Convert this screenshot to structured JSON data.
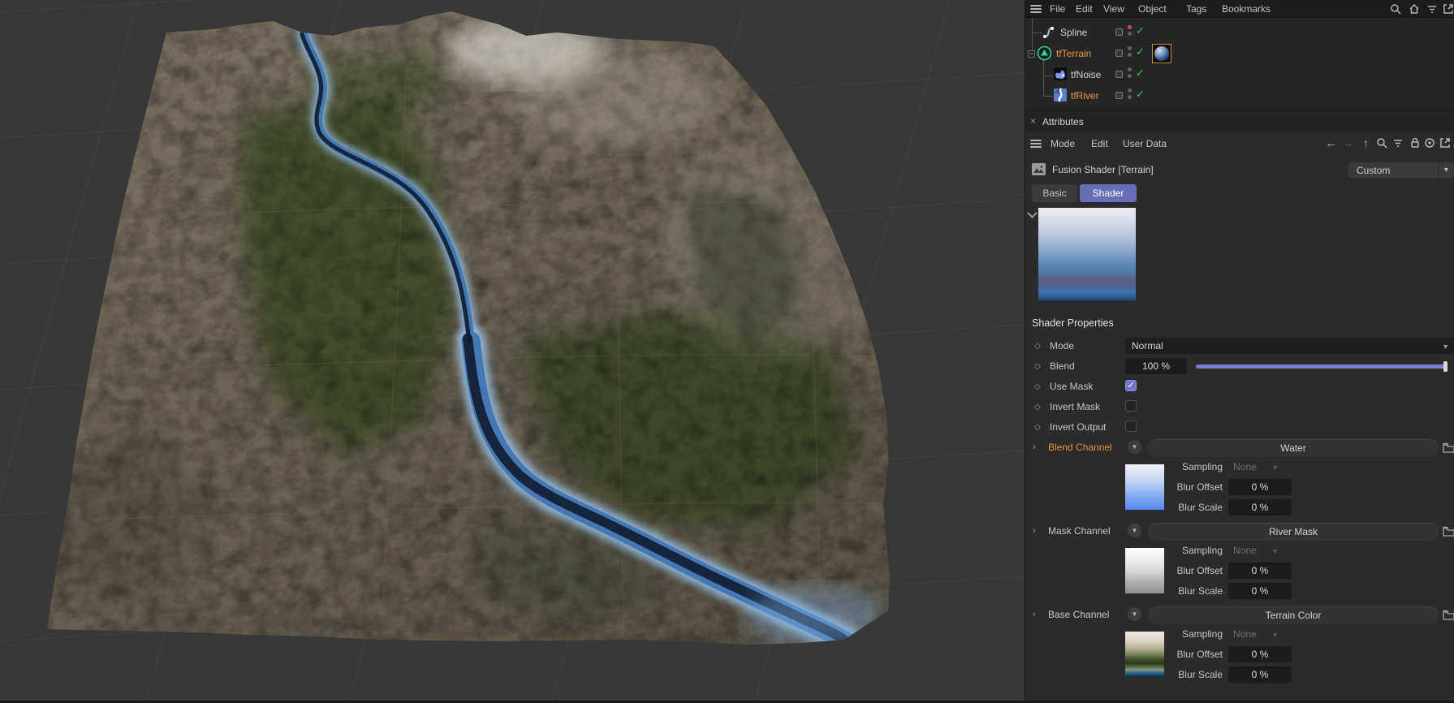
{
  "menubar": {
    "items": [
      "File",
      "Edit",
      "View",
      "Object",
      "Tags",
      "Bookmarks"
    ],
    "right_icons": [
      "search-icon",
      "home-icon",
      "filter-icon",
      "open-window-icon"
    ]
  },
  "object_tree": {
    "items": [
      {
        "name": "Spline",
        "icon": "spline-icon",
        "color": "#cfcfcf",
        "dot_top_color": "#cf4d43",
        "enabled_check": true
      },
      {
        "name": "tfTerrain",
        "icon": "terrain-operator-icon",
        "color": "#e39a45",
        "expanded": true,
        "has_material_thumbnail": true,
        "enabled_check": true
      },
      {
        "name": "tfNoise",
        "icon": "noise-icon",
        "color": "#cfcfcf",
        "enabled_check": true
      },
      {
        "name": "tfRiver",
        "icon": "river-icon",
        "color": "#e39a45",
        "enabled_check": true
      }
    ]
  },
  "attributes": {
    "title": "Attributes",
    "close_label": "×",
    "toolbar": {
      "items": [
        "Mode",
        "Edit",
        "User Data"
      ],
      "icons": [
        "back-arrow-icon",
        "forward-arrow-icon",
        "up-arrow-icon",
        "search-icon",
        "filter-icon",
        "lock-icon",
        "target-icon",
        "open-window-icon"
      ]
    },
    "object_header": {
      "title": "Fusion Shader [Terrain]",
      "preset": "Custom"
    },
    "tabs": [
      {
        "label": "Basic",
        "active": false
      },
      {
        "label": "Shader",
        "active": true
      }
    ],
    "section_title": "Shader Properties",
    "rows": {
      "mode": {
        "label": "Mode",
        "value": "Normal"
      },
      "blend": {
        "label": "Blend",
        "value": "100 %",
        "slider_percent": 100
      },
      "use_mask": {
        "label": "Use Mask",
        "checked": true
      },
      "invert_mask": {
        "label": "Invert Mask",
        "checked": false
      },
      "invert_output": {
        "label": "Invert Output",
        "checked": false
      }
    },
    "channels": [
      {
        "label": "Blend Channel",
        "label_color": "#e2913c",
        "value": "Water",
        "thumbnail": "white-to-blue-gradient",
        "sampling": {
          "label": "Sampling",
          "value": "None",
          "disabled": true
        },
        "blur_offset": {
          "label": "Blur Offset",
          "value": "0 %"
        },
        "blur_scale": {
          "label": "Blur Scale",
          "value": "0 %"
        }
      },
      {
        "label": "Mask Channel",
        "label_color": "#c9c9c9",
        "value": "River Mask",
        "thumbnail": "white-to-gray-gradient",
        "sampling": {
          "label": "Sampling",
          "value": "None",
          "disabled": true
        },
        "blur_offset": {
          "label": "Blur Offset",
          "value": "0 %"
        },
        "blur_scale": {
          "label": "Blur Scale",
          "value": "0 %"
        }
      },
      {
        "label": "Base Channel",
        "label_color": "#c9c9c9",
        "value": "Terrain Color",
        "thumbnail": "terrain-color-gradient",
        "sampling": {
          "label": "Sampling",
          "value": "None",
          "disabled": true
        },
        "blur_offset": {
          "label": "Blur Offset",
          "value": "0 %"
        },
        "blur_scale": {
          "label": "Blur Scale",
          "value": "0 %"
        }
      }
    ]
  },
  "viewport": {
    "content": "3D terrain mesh with winding blue river in perspective view",
    "colors": {
      "background": "#383838",
      "grid_line": "#474747",
      "rock_light": "#a79f8f",
      "rock_dark": "#5f594e",
      "vegetation": "#31401f",
      "river_glow": "#9cc8f2",
      "river_mid": "#4577b4",
      "river_core": "#101c30"
    }
  },
  "theme": {
    "panel_bg": "#2b2b2b",
    "accent_purple": "#686db8",
    "accent_orange": "#e2913c",
    "check_green": "#46c24c",
    "slider_purple": "#787dd2"
  }
}
